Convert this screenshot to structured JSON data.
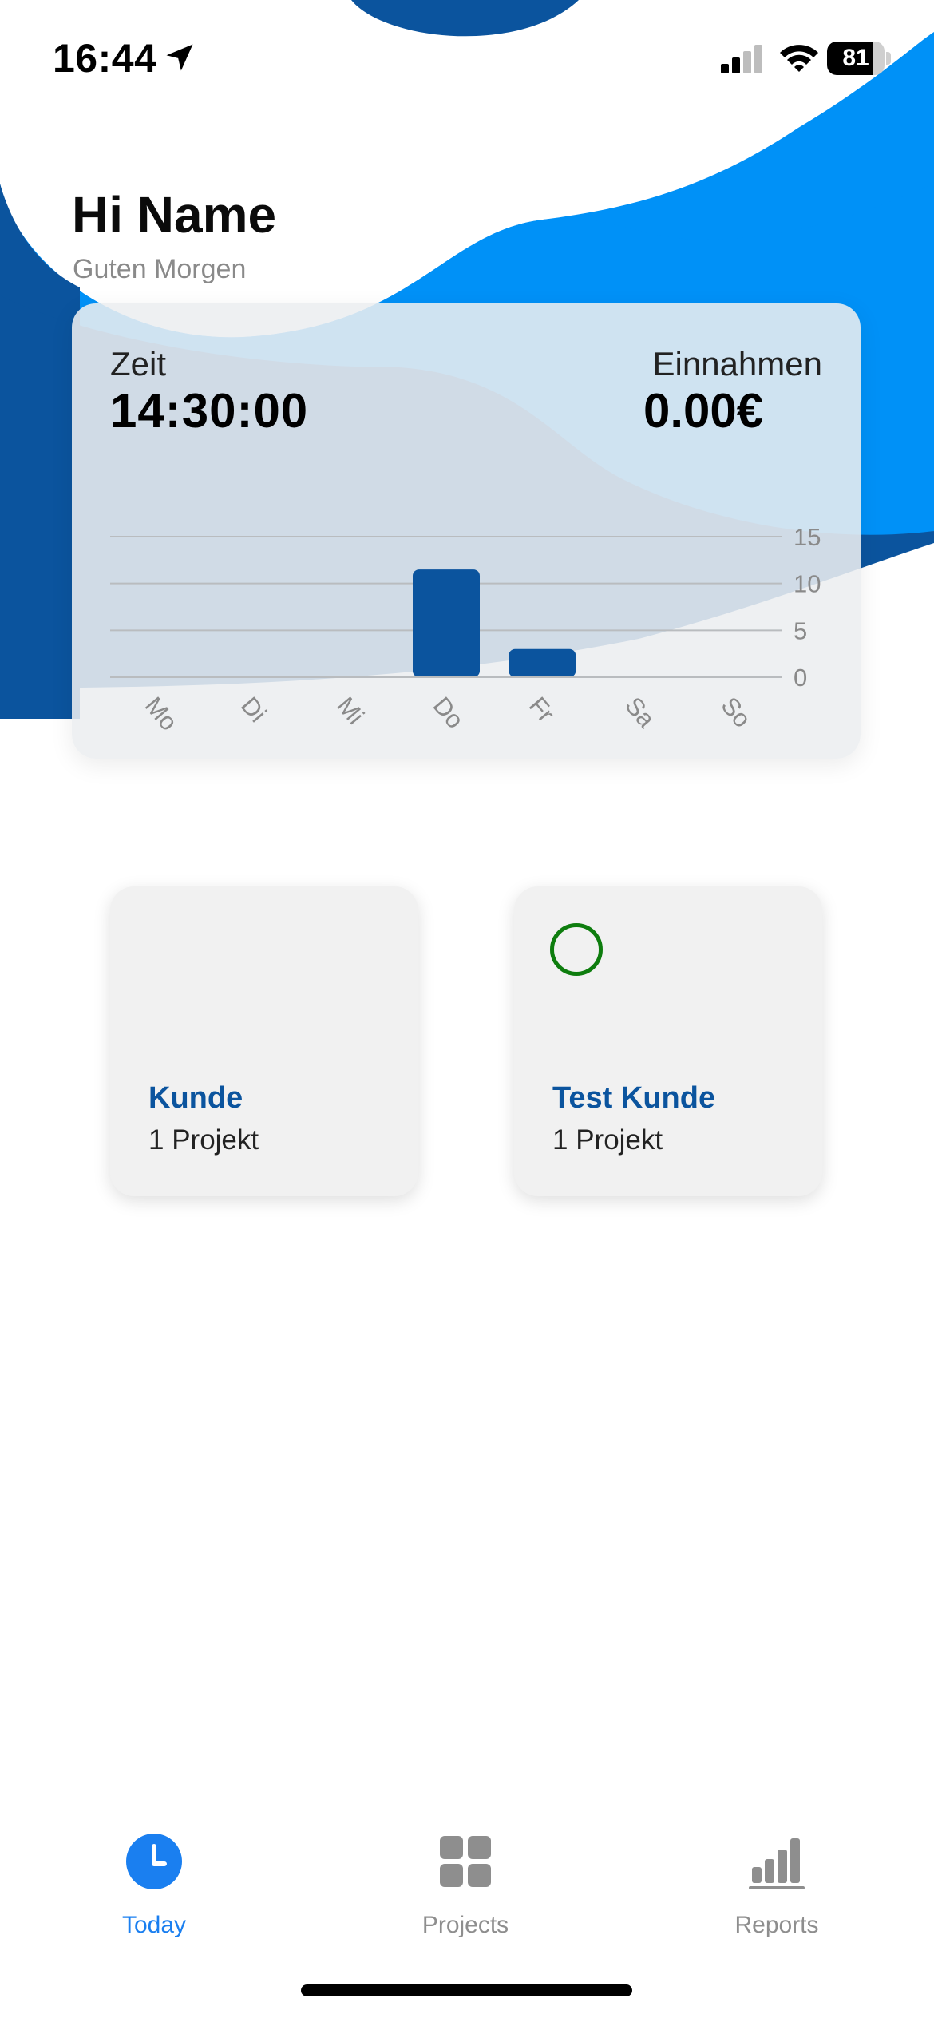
{
  "status_bar": {
    "time": "16:44",
    "battery": "81",
    "battery_level": 0.81
  },
  "greeting": {
    "title": "Hi Name",
    "subtitle": "Guten Morgen"
  },
  "summary": {
    "time_label": "Zeit",
    "time_value": "14:30:00",
    "income_label": "Einnahmen",
    "income_value": "0.00€"
  },
  "chart_data": {
    "type": "bar",
    "categories": [
      "Mo",
      "Di",
      "Mi",
      "Do",
      "Fr",
      "Sa",
      "So"
    ],
    "values": [
      0,
      0,
      0,
      11.5,
      3,
      0,
      0
    ],
    "yticks": [
      "0",
      "5",
      "10",
      "15"
    ],
    "ylim": [
      0,
      15
    ],
    "bar_color": "#0b549e",
    "grid": true
  },
  "customers": [
    {
      "name": "Kunde",
      "projects": "1 Projekt",
      "status_icon": ""
    },
    {
      "name": "Test Kunde",
      "projects": "1 Projekt",
      "status_icon": "circle-outline-icon"
    }
  ],
  "tabs": [
    {
      "label": "Today",
      "icon": "clock-icon",
      "active": true
    },
    {
      "label": "Projects",
      "icon": "grid-icon",
      "active": false
    },
    {
      "label": "Reports",
      "icon": "bar-chart-icon",
      "active": false
    }
  ],
  "colors": {
    "brand_dark": "#0b549e",
    "brand_light": "#0091f7",
    "active_tab": "#1a7ff0",
    "inactive_tab": "#8e8e8e",
    "status_green": "#0e7d0e"
  }
}
